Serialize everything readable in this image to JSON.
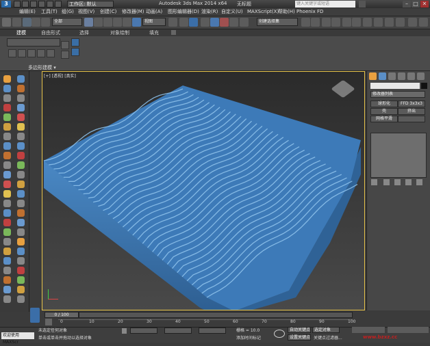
{
  "title_bar": {
    "logo": "3",
    "workspace": "工作区: 默认",
    "app_title": "Autodesk 3ds Max  2014 x64",
    "document": "无标题",
    "search_placeholder": "键入关键字或短语",
    "minimize": "–",
    "maximize": "□",
    "close": "✕"
  },
  "menu": [
    "编辑(E)",
    "工具(T)",
    "组(G)",
    "视图(V)",
    "创建(C)",
    "修改器(M)",
    "动画(A)",
    "图形编辑器(D)",
    "渲染(R)",
    "自定义(U)",
    "MAXScript(X)",
    "帮助(H)",
    "Phoenix FD"
  ],
  "toolbar": {
    "selection_filter": "全部",
    "ref_coord": "视图",
    "named_selection": "创建选择集"
  },
  "ribbon": {
    "tabs": [
      "建模",
      "自由形式",
      "选择",
      "对象绘制",
      "填充"
    ],
    "footer": "多边形建模 ▾"
  },
  "viewport": {
    "label": "[+] [透视] [真实]"
  },
  "command_panel": {
    "modifier_list": "修改器列表",
    "buttons": [
      "球形化",
      "FFD 3x3x3",
      "壳",
      "挤出",
      "网格平滑",
      ""
    ]
  },
  "timeline": {
    "frame": "0 / 100",
    "ticks": [
      "0",
      "10",
      "20",
      "30",
      "40",
      "50",
      "60",
      "70",
      "80",
      "90",
      "100"
    ]
  },
  "status": {
    "welcome": "欢迎使用 MAXScr",
    "line1": "未选定任何对象",
    "line2": "单击或单击并拖动以选择对象",
    "grid": "栅格 = 10.0",
    "add_time_tag": "添加时间标记",
    "auto_key": "自动关键点",
    "set_key": "设置关键点",
    "selected": "选定对象",
    "key_filters": "关键点过滤器...",
    "watermark": "www.bzxz.cc"
  },
  "colors": {
    "accent": "#e8c44a",
    "mesh": "#3d7ab8",
    "bg": "#3b3b3b"
  }
}
